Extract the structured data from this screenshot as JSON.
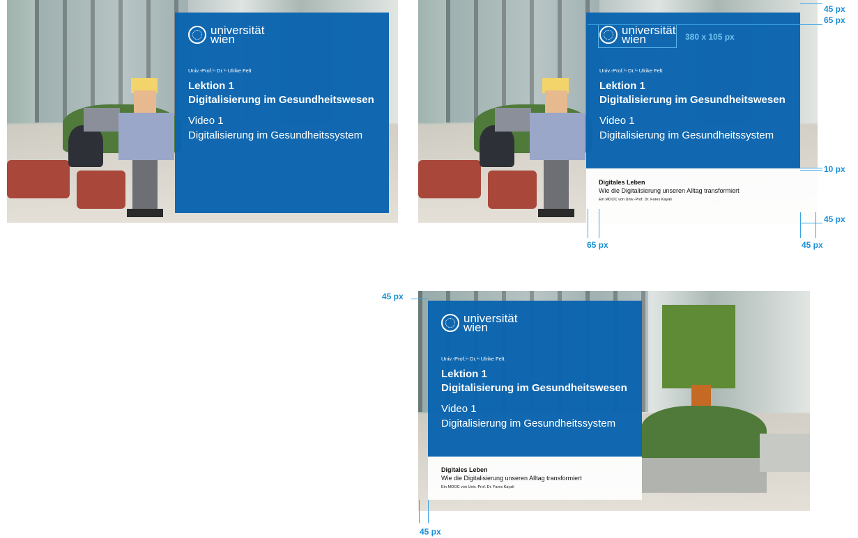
{
  "slide": {
    "logo_line1": "universität",
    "logo_line2": "wien",
    "professor": "Univ.-Prof.ⁱⁿ Dr.ⁱⁿ Ulrike Felt",
    "lektion_line1": "Lektion 1",
    "lektion_line2": "Digitalisierung im Gesundheitswesen",
    "video_line1": "Video 1",
    "video_line2": "Digitalisierung im Gesundheitssystem"
  },
  "band": {
    "title": "Digitales Leben",
    "subtitle": "Wie die Digitalisierung unseren Alltag transformiert",
    "credit": "Ein MOOC von Univ.-Prof. Dr. Fares Kayali"
  },
  "annotations": {
    "top_45": "45 px",
    "top_65": "65 px",
    "logo_size": "380 x 105 px",
    "band_gap": "10 px",
    "right_45": "45 px",
    "bottom_65": "65 px",
    "bottom_45": "45 px",
    "frame3_top": "45 px",
    "frame3_bottom": "45 px"
  },
  "colors": {
    "brand_blue": "#0a64af",
    "annotation_blue": "#1a8fd6"
  }
}
